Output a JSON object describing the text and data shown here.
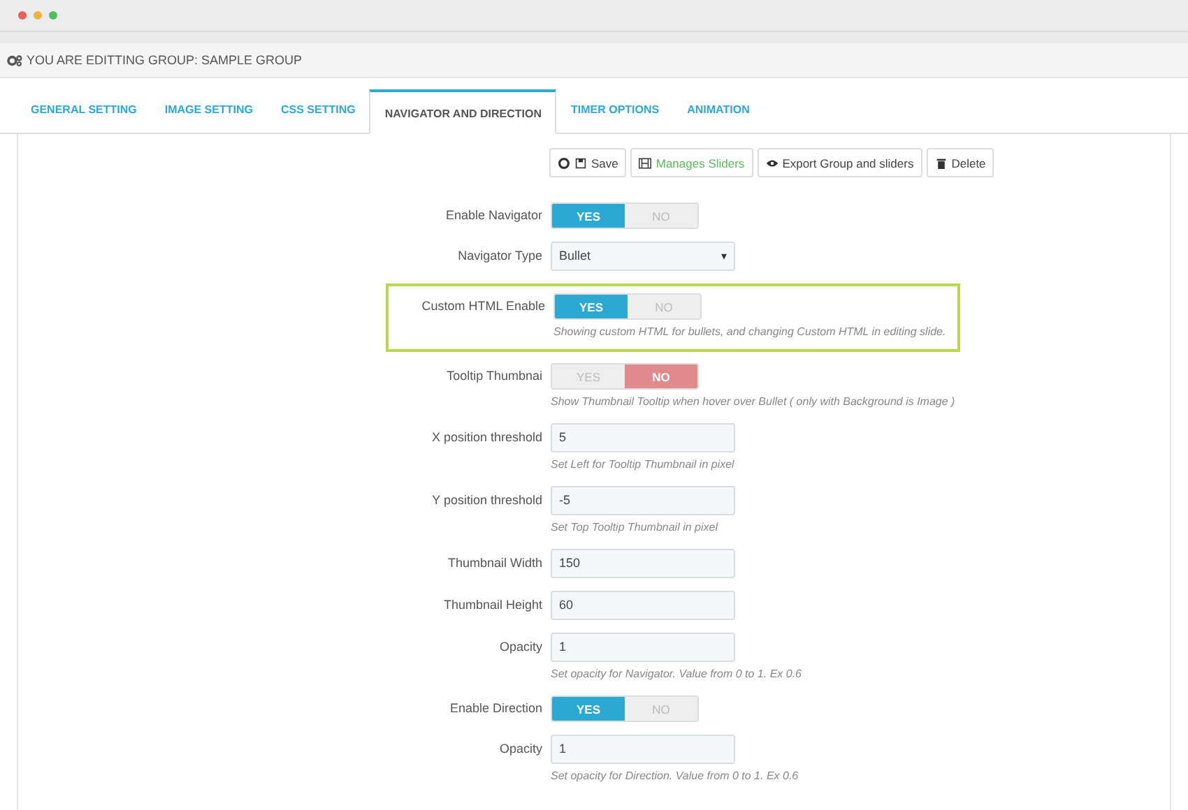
{
  "header": {
    "title": "YOU ARE EDITTING GROUP: SAMPLE GROUP"
  },
  "tabs": [
    {
      "label": "GENERAL SETTING",
      "selected": false
    },
    {
      "label": "IMAGE SETTING",
      "selected": false
    },
    {
      "label": "CSS SETTING",
      "selected": false
    },
    {
      "label": "NAVIGATOR AND DIRECTION",
      "selected": true
    },
    {
      "label": "TIMER OPTIONS",
      "selected": false
    },
    {
      "label": "ANIMATION",
      "selected": false
    }
  ],
  "toolbar": [
    {
      "kind": "save",
      "label": "Save"
    },
    {
      "kind": "sliders",
      "label": "Manages Sliders"
    },
    {
      "kind": "export",
      "label": "Export Group and sliders"
    },
    {
      "kind": "delete",
      "label": "Delete"
    }
  ],
  "fields": [
    {
      "kind": "toggle",
      "label": "Enable Navigator",
      "highlighted": false,
      "options": [
        {
          "label": "YES",
          "selected": true
        },
        {
          "label": "NO",
          "selected": false
        }
      ]
    },
    {
      "kind": "select",
      "label": "Navigator Type",
      "highlighted": false,
      "value": "Bullet",
      "caret": "▾"
    },
    {
      "kind": "toggle",
      "label": "Custom HTML Enable",
      "highlighted": true,
      "options": [
        {
          "label": "YES",
          "selected": true
        },
        {
          "label": "NO",
          "selected": false
        }
      ],
      "hint": "Showing custom HTML for bullets, and changing Custom HTML in editing slide."
    },
    {
      "kind": "toggle",
      "label": "Tooltip Thumbnai",
      "highlighted": false,
      "options": [
        {
          "label": "YES",
          "selected": false
        },
        {
          "label": "NO",
          "selected": true
        }
      ],
      "hint": "Show Thumbnail Tooltip when hover over Bullet ( only with Background is Image )"
    },
    {
      "kind": "input",
      "label": "X position threshold",
      "highlighted": false,
      "value": "5",
      "hint": "Set Left for Tooltip Thumbnail in pixel"
    },
    {
      "kind": "input",
      "label": "Y position threshold",
      "highlighted": false,
      "value": "-5",
      "hint": "Set Top Tooltip Thumbnail in pixel"
    },
    {
      "kind": "input",
      "label": "Thumbnail Width",
      "highlighted": false,
      "value": "150"
    },
    {
      "kind": "input",
      "label": "Thumbnail Height",
      "highlighted": false,
      "value": "60"
    },
    {
      "kind": "input",
      "label": "Opacity",
      "highlighted": false,
      "value": "1",
      "hint": "Set opacity for Navigator. Value from 0 to 1. Ex 0.6"
    },
    {
      "kind": "toggle",
      "label": "Enable Direction",
      "highlighted": false,
      "options": [
        {
          "label": "YES",
          "selected": true
        },
        {
          "label": "NO",
          "selected": false
        }
      ]
    },
    {
      "kind": "input",
      "label": "Opacity",
      "highlighted": false,
      "value": "1",
      "hint": "Set opacity for Direction. Value from 0 to 1. Ex 0.6"
    }
  ]
}
